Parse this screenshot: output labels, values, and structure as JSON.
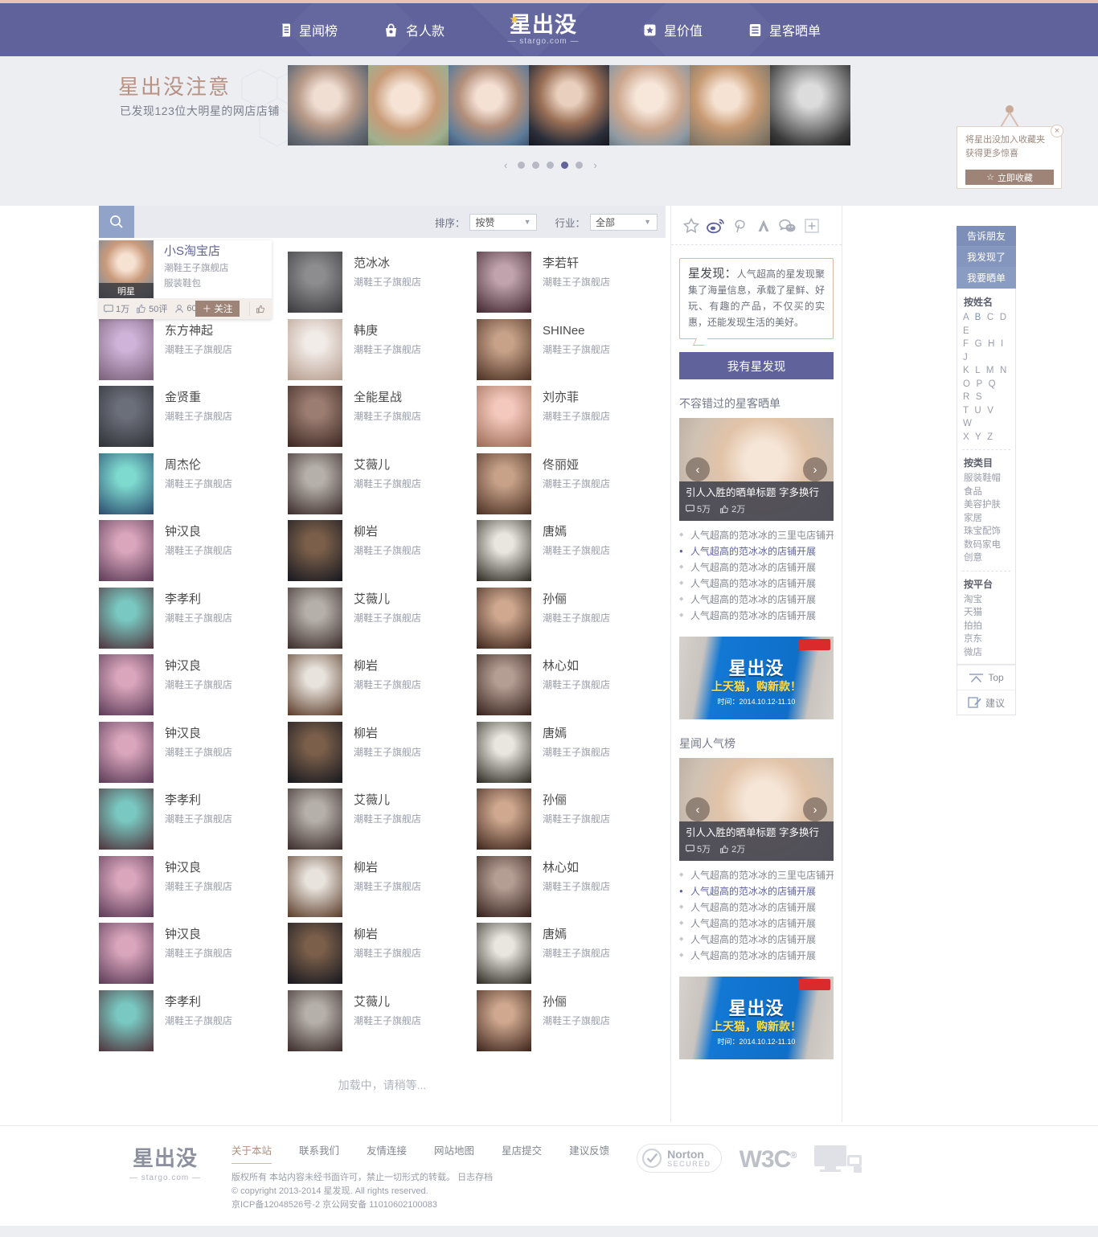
{
  "header": {
    "nav_left": [
      {
        "label": "星闻榜",
        "icon": "book-icon"
      },
      {
        "label": "名人款",
        "icon": "bag-icon"
      }
    ],
    "nav_right": [
      {
        "label": "星价值",
        "icon": "star-box-icon"
      },
      {
        "label": "星客晒单",
        "icon": "list-icon"
      }
    ],
    "brand": {
      "main": "星出没",
      "sub": "— stargo.com —"
    }
  },
  "banner": {
    "title": "星出没注意",
    "subtitle": "已发现123位大明星的网店店铺",
    "dots": 6,
    "active_dot": 5,
    "prev": "‹",
    "next": "›"
  },
  "bookmark": {
    "line1": "将星出没加入收藏夹",
    "line2": "获得更多惊喜",
    "button": "立即收藏",
    "close": "×"
  },
  "toolbar": {
    "search_icon": "search-icon",
    "sort_label": "排序：",
    "sort_value": "按赞",
    "industry_label": "行业：",
    "industry_value": "全部"
  },
  "hovercard": {
    "name": "小S淘宝店",
    "shop": "潮鞋王子旗舰店",
    "category": "服装鞋包",
    "badge": "明星",
    "comments": "1万",
    "reviews": "50评",
    "fans": "60",
    "follow": "＋ 关注"
  },
  "grid": {
    "shop_label": "潮鞋王子旗舰店",
    "items": [
      {
        "name": "小S淘宝店",
        "shop": "潮鞋王子旗舰店",
        "c1": "#dfe3ea",
        "c2": "#8f8272"
      },
      {
        "name": "范冰冰",
        "shop": "潮鞋王子旗舰店",
        "c1": "#8d8d8f",
        "c2": "#3a3a3c"
      },
      {
        "name": "李若轩",
        "shop": "潮鞋王子旗舰店",
        "c1": "#c0a3ad",
        "c2": "#40262f"
      },
      {
        "name": "东方神起",
        "shop": "潮鞋王子旗舰店",
        "c1": "#cfb3d8",
        "c2": "#7a5f79"
      },
      {
        "name": "韩庚",
        "shop": "潮鞋王子旗舰店",
        "c1": "#f2ece8",
        "c2": "#b59b8c"
      },
      {
        "name": "SHINee",
        "shop": "潮鞋王子旗舰店",
        "c1": "#c7a289",
        "c2": "#4a2f22"
      },
      {
        "name": "金贤重",
        "shop": "潮鞋王子旗舰店",
        "c1": "#6b6f7a",
        "c2": "#2f3136"
      },
      {
        "name": "全能星战",
        "shop": "潮鞋王子旗舰店",
        "c1": "#9c7d72",
        "c2": "#3b2721"
      },
      {
        "name": "刘亦菲",
        "shop": "潮鞋王子旗舰店",
        "c1": "#f4c9bd",
        "c2": "#9c6a55"
      },
      {
        "name": "周杰伦",
        "shop": "潮鞋王子旗舰店",
        "c1": "#7ed9cf",
        "c2": "#2a4a6e"
      },
      {
        "name": "艾薇儿",
        "shop": "潮鞋王子旗舰店",
        "c1": "#b6b0ab",
        "c2": "#3a2b27"
      },
      {
        "name": "佟丽娅",
        "shop": "潮鞋王子旗舰店",
        "c1": "#c7a289",
        "c2": "#4a2f22"
      },
      {
        "name": "钟汉良",
        "shop": "潮鞋王子旗舰店",
        "c1": "#d9a6bc",
        "c2": "#5b3a57"
      },
      {
        "name": "柳岩",
        "shop": "潮鞋王子旗舰店",
        "c1": "#7b5f4a",
        "c2": "#15171f"
      },
      {
        "name": "唐嫣",
        "shop": "潮鞋王子旗舰店",
        "c1": "#e9e6e0",
        "c2": "#2b2721"
      },
      {
        "name": "李孝利",
        "shop": "潮鞋王子旗舰店",
        "c1": "#79c9c2",
        "c2": "#50323a"
      },
      {
        "name": "艾薇儿",
        "shop": "潮鞋王子旗舰店",
        "c1": "#b6b0ab",
        "c2": "#3a2b27"
      },
      {
        "name": "孙俪",
        "shop": "潮鞋王子旗舰店",
        "c1": "#cfa88f",
        "c2": "#3c241b"
      },
      {
        "name": "钟汉良",
        "shop": "潮鞋王子旗舰店",
        "c1": "#d9a6bc",
        "c2": "#5b3a57"
      },
      {
        "name": "柳岩",
        "shop": "潮鞋王子旗舰店",
        "c1": "#e8e3dc",
        "c2": "#5a3a28"
      },
      {
        "name": "林心如",
        "shop": "潮鞋王子旗舰店",
        "c1": "#b49d93",
        "c2": "#332019"
      },
      {
        "name": "钟汉良",
        "shop": "潮鞋王子旗舰店",
        "c1": "#d9a6bc",
        "c2": "#5b3a57"
      },
      {
        "name": "柳岩",
        "shop": "潮鞋王子旗舰店",
        "c1": "#7b5f4a",
        "c2": "#15171f"
      },
      {
        "name": "唐嫣",
        "shop": "潮鞋王子旗舰店",
        "c1": "#e9e6e0",
        "c2": "#2b2721"
      },
      {
        "name": "李孝利",
        "shop": "潮鞋王子旗舰店",
        "c1": "#79c9c2",
        "c2": "#50323a"
      },
      {
        "name": "艾薇儿",
        "shop": "潮鞋王子旗舰店",
        "c1": "#b6b0ab",
        "c2": "#3a2b27"
      },
      {
        "name": "孙俪",
        "shop": "潮鞋王子旗舰店",
        "c1": "#cfa88f",
        "c2": "#3c241b"
      },
      {
        "name": "钟汉良",
        "shop": "潮鞋王子旗舰店",
        "c1": "#d9a6bc",
        "c2": "#5b3a57"
      },
      {
        "name": "柳岩",
        "shop": "潮鞋王子旗舰店",
        "c1": "#e8e3dc",
        "c2": "#5a3a28"
      },
      {
        "name": "林心如",
        "shop": "潮鞋王子旗舰店",
        "c1": "#b49d93",
        "c2": "#332019"
      },
      {
        "name": "钟汉良",
        "shop": "潮鞋王子旗舰店",
        "c1": "#d9a6bc",
        "c2": "#5b3a57"
      },
      {
        "name": "柳岩",
        "shop": "潮鞋王子旗舰店",
        "c1": "#7b5f4a",
        "c2": "#15171f"
      },
      {
        "name": "唐嫣",
        "shop": "潮鞋王子旗舰店",
        "c1": "#e9e6e0",
        "c2": "#2b2721"
      },
      {
        "name": "李孝利",
        "shop": "潮鞋王子旗舰店",
        "c1": "#79c9c2",
        "c2": "#50323a"
      },
      {
        "name": "艾薇儿",
        "shop": "潮鞋王子旗舰店",
        "c1": "#b6b0ab",
        "c2": "#3a2b27"
      },
      {
        "name": "孙俪",
        "shop": "潮鞋王子旗舰店",
        "c1": "#cfa88f",
        "c2": "#3c241b"
      }
    ],
    "loading": "加载中，请稍等..."
  },
  "sidebar": {
    "social_icons": [
      "favorite-star-icon",
      "weibo-icon",
      "pinterest-icon",
      "alipay-icon",
      "wechat-icon",
      "plus-icon"
    ],
    "discover_title": "星发现：",
    "discover_text": "人气超高的星发现聚集了海量信息，承载了星鲜、好玩、有趣的产品，不仅买的实惠，还能发现生活的美好。",
    "discover_button": "我有星发现",
    "section1_title": "不容错过的星客晒单",
    "promo1": {
      "caption": "引人入胜的晒单标题 字多换行",
      "comments": "5万",
      "likes": "2万",
      "prev": "‹",
      "next": "›"
    },
    "news1": [
      {
        "text": "人气超高的范冰冰的三里屯店铺开展",
        "active": false
      },
      {
        "text": "人气超高的范冰冰的店铺开展",
        "active": true
      },
      {
        "text": "人气超高的范冰冰的店铺开展",
        "active": false
      },
      {
        "text": "人气超高的范冰冰的店铺开展",
        "active": false
      },
      {
        "text": "人气超高的范冰冰的店铺开展",
        "active": false
      },
      {
        "text": "人气超高的范冰冰的店铺开展",
        "active": false
      }
    ],
    "tmall": {
      "title": "星出没",
      "slogan": "上天猫，购新款！",
      "time": "时间：2014.10.12-11.10"
    },
    "section2_title": "星闻人气榜",
    "promo2": {
      "caption": "引人入胜的晒单标题 字多换行",
      "comments": "5万",
      "likes": "2万",
      "prev": "‹",
      "next": "›"
    },
    "news2": [
      {
        "text": "人气超高的范冰冰的三里屯店铺开展",
        "active": false
      },
      {
        "text": "人气超高的范冰冰的店铺开展",
        "active": true
      },
      {
        "text": "人气超高的范冰冰的店铺开展",
        "active": false
      },
      {
        "text": "人气超高的范冰冰的店铺开展",
        "active": false
      },
      {
        "text": "人气超高的范冰冰的店铺开展",
        "active": false
      },
      {
        "text": "人气超高的范冰冰的店铺开展",
        "active": false
      }
    ]
  },
  "floatbar": {
    "buttons": [
      "告诉朋友",
      "我发现了",
      "我要晒单"
    ],
    "by_name_title": "按姓名",
    "letters_rows": [
      "A B C D E",
      "F G H I J",
      "K L M N",
      "O P Q R S",
      "T U V W",
      "X Y Z"
    ],
    "active_letter": "B",
    "by_category_title": "按类目",
    "categories": [
      "服装鞋帽",
      "食品",
      "美容护肤",
      "家居",
      "珠宝配饰",
      "数码家电",
      "创意"
    ],
    "by_platform_title": "按平台",
    "platforms": [
      "淘宝",
      "天猫",
      "拍拍",
      "京东",
      "微店"
    ],
    "top_label": "Top",
    "suggest_label": "建议"
  },
  "footer": {
    "logo_main": "星出没",
    "logo_sub": "— stargo.com —",
    "links": [
      {
        "label": "关于本站",
        "active": true
      },
      {
        "label": "联系我们",
        "active": false
      },
      {
        "label": "友情连接",
        "active": false
      },
      {
        "label": "网站地图",
        "active": false
      },
      {
        "label": "星店提交",
        "active": false
      },
      {
        "label": "建议反馈",
        "active": false
      }
    ],
    "copy1": "版权所有 本站内容未经书面许可，禁止一切形式的转载。 日志存档",
    "copy2": "© copyright 2013-2014 星发现. All rights reserved.",
    "copy3": "京ICP备12048526号-2 京公网安备 11010602100083",
    "badge_norton_1": "Norton",
    "badge_norton_2": "SECURED",
    "badge_w3c": "W3C"
  }
}
